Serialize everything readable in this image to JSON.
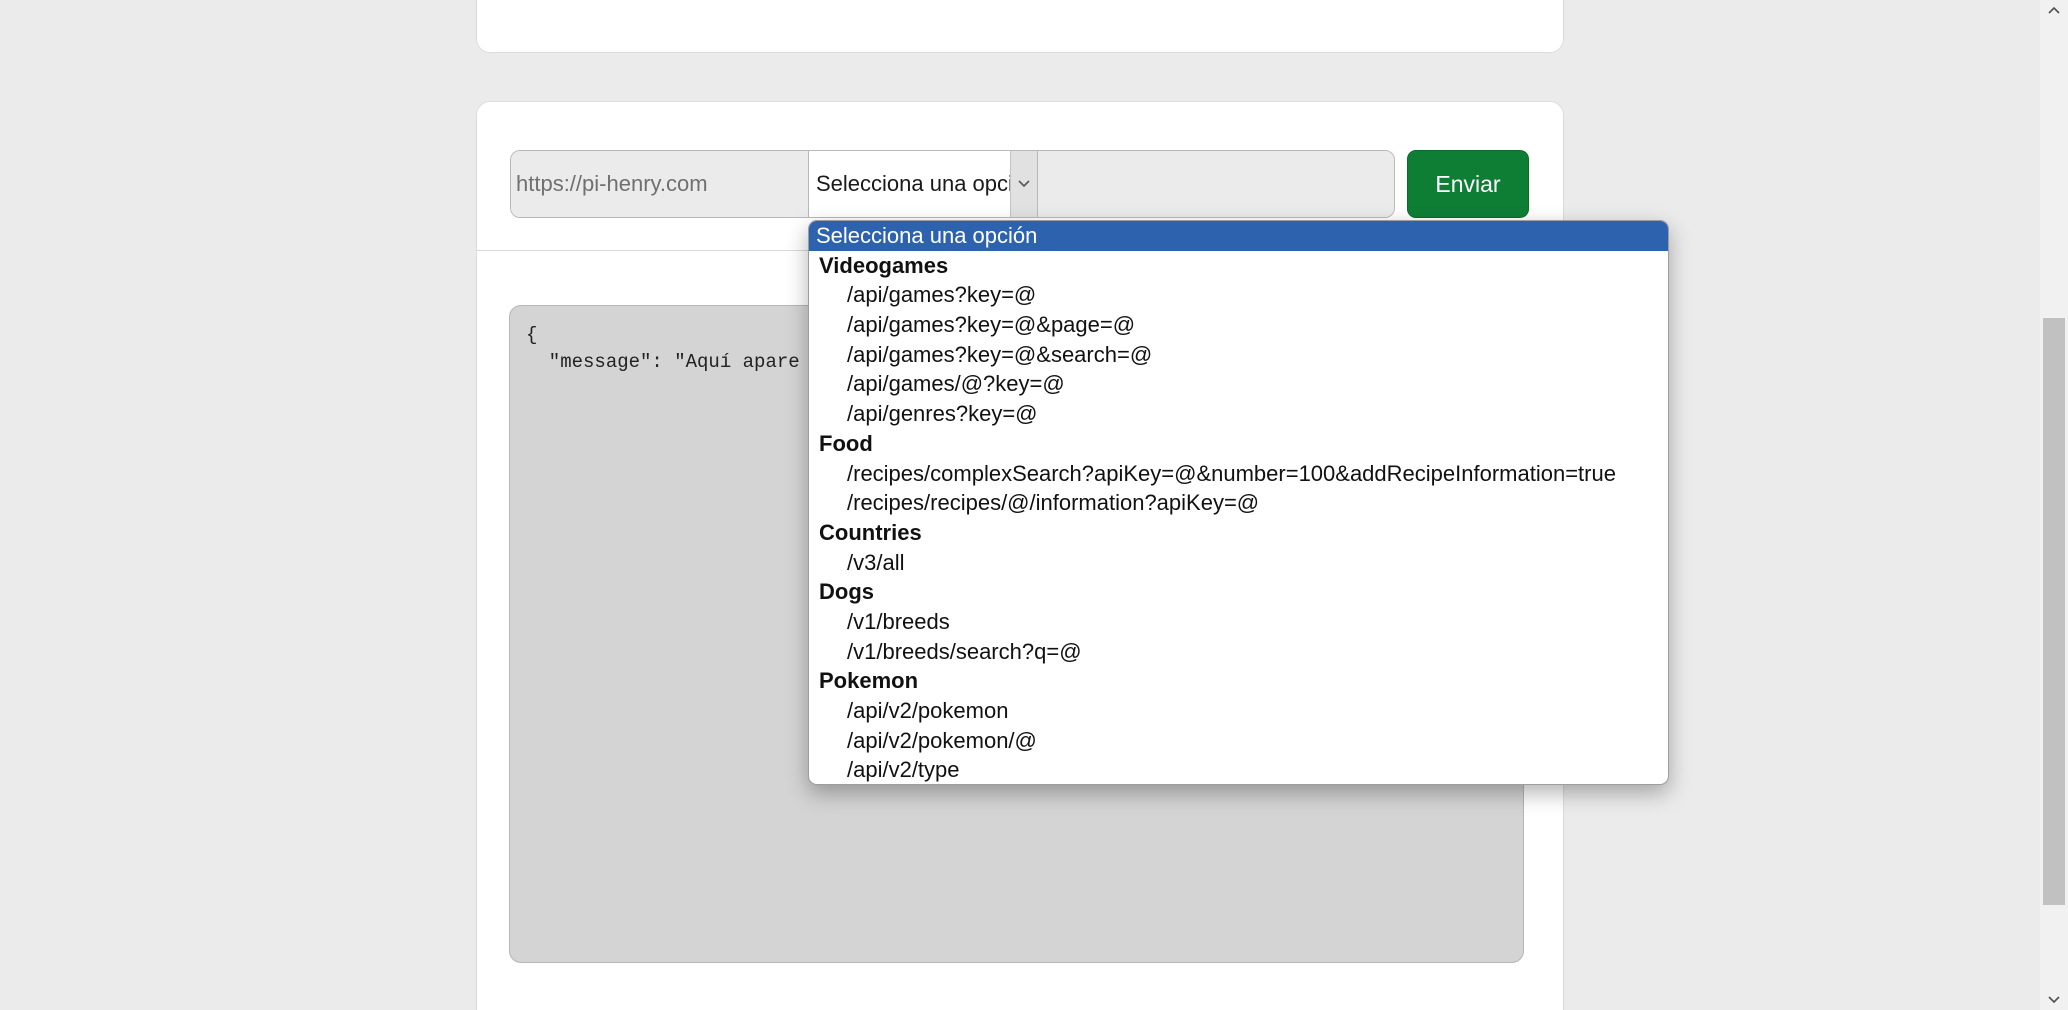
{
  "request": {
    "base_url": "https://pi-henry.com",
    "selected_option": "Selecciona una opción",
    "param_value": "",
    "send_label": "Enviar"
  },
  "response": {
    "text": "{\n  \"message\": \"Aquí apare"
  },
  "dropdown": {
    "selected_label": "Selecciona una opción",
    "groups": [
      {
        "label": "Videogames",
        "options": [
          "/api/games?key=@",
          "/api/games?key=@&page=@",
          "/api/games?key=@&search=@",
          "/api/games/@?key=@",
          "/api/genres?key=@"
        ]
      },
      {
        "label": "Food",
        "options": [
          "/recipes/complexSearch?apiKey=@&number=100&addRecipeInformation=true",
          "/recipes/recipes/@/information?apiKey=@"
        ]
      },
      {
        "label": "Countries",
        "options": [
          "/v3/all"
        ]
      },
      {
        "label": "Dogs",
        "options": [
          "/v1/breeds",
          "/v1/breeds/search?q=@"
        ]
      },
      {
        "label": "Pokemon",
        "options": [
          "/api/v2/pokemon",
          "/api/v2/pokemon/@",
          "/api/v2/type"
        ]
      }
    ]
  },
  "icons": {
    "select_arrow": "chevron-down-icon",
    "scroll_up": "scroll-up-arrow-icon",
    "scroll_down": "scroll-down-arrow-icon"
  },
  "colors": {
    "send_button": "#0f7e35",
    "dropdown_highlight": "#2d62ae",
    "page_background": "#ebebeb",
    "response_background": "#d4d4d4"
  }
}
